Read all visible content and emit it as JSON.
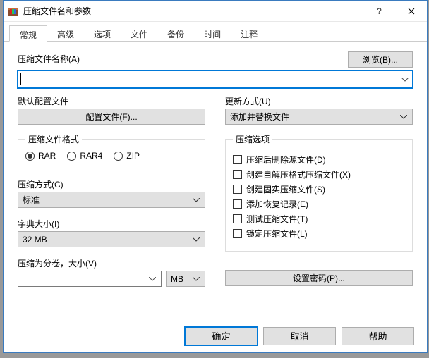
{
  "title": "压缩文件名和参数",
  "tabs": [
    "常规",
    "高级",
    "选项",
    "文件",
    "备份",
    "时间",
    "注释"
  ],
  "selected_tab": 0,
  "name_label": "压缩文件名称(A)",
  "browse_label": "浏览(B)...",
  "filename_value": "",
  "default_profile_label": "默认配置文件",
  "profiles_btn": "配置文件(F)...",
  "update_label": "更新方式(U)",
  "update_value": "添加并替换文件",
  "format_label": "压缩文件格式",
  "formats": {
    "rar": "RAR",
    "rar4": "RAR4",
    "zip": "ZIP"
  },
  "format_selected": "rar",
  "method_label": "压缩方式(C)",
  "method_value": "标准",
  "dict_label": "字典大小(I)",
  "dict_value": "32 MB",
  "split_label": "压缩为分卷，大小(V)",
  "split_value": "",
  "split_unit": "MB",
  "options_label": "压缩选项",
  "options": {
    "delete": "压缩后删除源文件(D)",
    "sfx": "创建自解压格式压缩文件(X)",
    "solid": "创建固实压缩文件(S)",
    "recovery": "添加恢复记录(E)",
    "test": "测试压缩文件(T)",
    "lock": "锁定压缩文件(L)"
  },
  "password_btn": "设置密码(P)...",
  "footer": {
    "ok": "确定",
    "cancel": "取消",
    "help": "帮助"
  }
}
